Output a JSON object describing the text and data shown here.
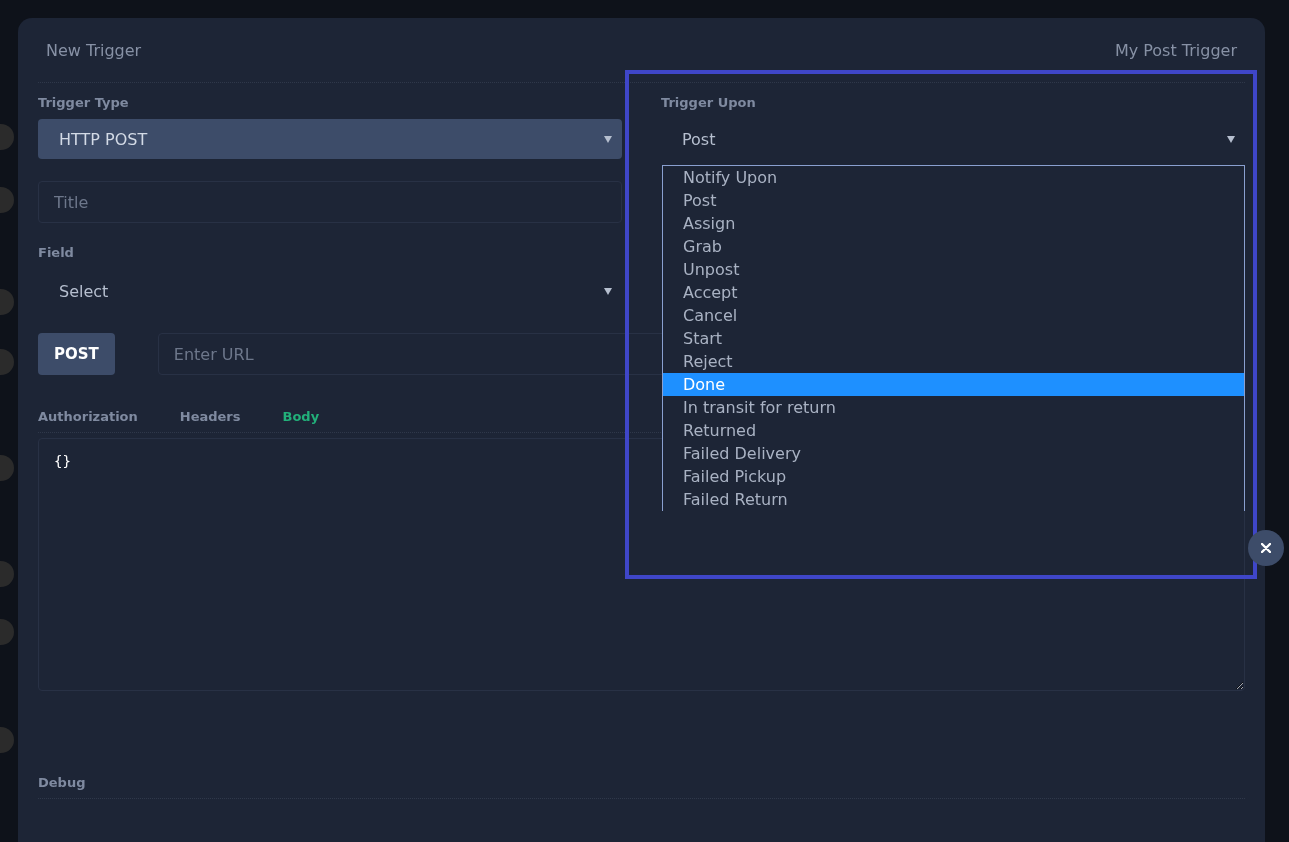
{
  "header": {
    "title": "New Trigger",
    "name": "My Post Trigger"
  },
  "trigger_type": {
    "label": "Trigger Type",
    "value": "HTTP POST"
  },
  "title_field": {
    "placeholder": "Title"
  },
  "field": {
    "label": "Field",
    "value": "Select"
  },
  "method_button": "POST",
  "url_field": {
    "placeholder": "Enter URL"
  },
  "tabs": [
    {
      "label": "Authorization",
      "selected": false
    },
    {
      "label": "Headers",
      "selected": false
    },
    {
      "label": "Body",
      "selected": true
    }
  ],
  "body": {
    "value": "{}"
  },
  "debug": {
    "label": "Debug"
  },
  "trigger_upon": {
    "label": "Trigger Upon",
    "value": "Post",
    "expanded": true,
    "options": [
      {
        "label": "Notify Upon",
        "highlighted": false
      },
      {
        "label": "Post",
        "highlighted": false
      },
      {
        "label": "Assign",
        "highlighted": false
      },
      {
        "label": "Grab",
        "highlighted": false
      },
      {
        "label": "Unpost",
        "highlighted": false
      },
      {
        "label": "Accept",
        "highlighted": false
      },
      {
        "label": "Cancel",
        "highlighted": false
      },
      {
        "label": "Start",
        "highlighted": false
      },
      {
        "label": "Reject",
        "highlighted": false
      },
      {
        "label": "Done",
        "highlighted": true
      },
      {
        "label": "In transit for return",
        "highlighted": false
      },
      {
        "label": "Returned",
        "highlighted": false
      },
      {
        "label": "Failed Delivery",
        "highlighted": false
      },
      {
        "label": "Failed Pickup",
        "highlighted": false
      },
      {
        "label": "Failed Return",
        "highlighted": false
      }
    ]
  }
}
